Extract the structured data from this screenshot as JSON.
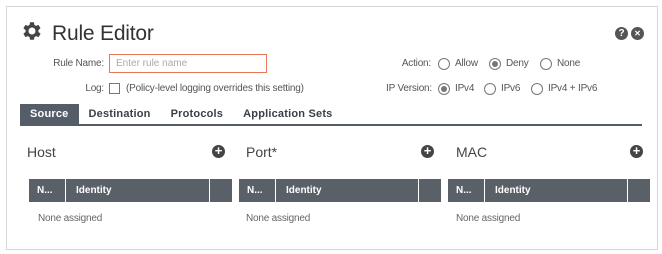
{
  "dialog": {
    "title": "Rule Editor",
    "title_icon": "gear-icon",
    "help_icon": "?",
    "close_icon": "✕"
  },
  "form": {
    "rule_name_label": "Rule Name:",
    "rule_name_value": "",
    "rule_name_placeholder": "Enter rule name",
    "log_label": "Log:",
    "log_checked": false,
    "log_note": "(Policy-level logging overrides this setting)",
    "action_label": "Action:",
    "action_options": [
      "Allow",
      "Deny",
      "None"
    ],
    "action_selected": "Deny",
    "ip_version_label": "IP Version:",
    "ip_version_options": [
      "IPv4",
      "IPv6",
      "IPv4 + IPv6"
    ],
    "ip_version_selected": "IPv4"
  },
  "tabs": [
    "Source",
    "Destination",
    "Protocols",
    "Application Sets"
  ],
  "active_tab": "Source",
  "columns": [
    {
      "title": "Host",
      "table_headers": [
        "N...",
        "Identity",
        ""
      ],
      "empty_text": "None assigned"
    },
    {
      "title": "Port*",
      "table_headers": [
        "N...",
        "Identity",
        ""
      ],
      "empty_text": "None assigned"
    },
    {
      "title": "MAC",
      "table_headers": [
        "N...",
        "Identity",
        ""
      ],
      "empty_text": "None assigned"
    }
  ],
  "colors": {
    "tab_active_bg": "#555d68",
    "table_header_bg": "#5a6068",
    "input_border": "#e8765a"
  }
}
